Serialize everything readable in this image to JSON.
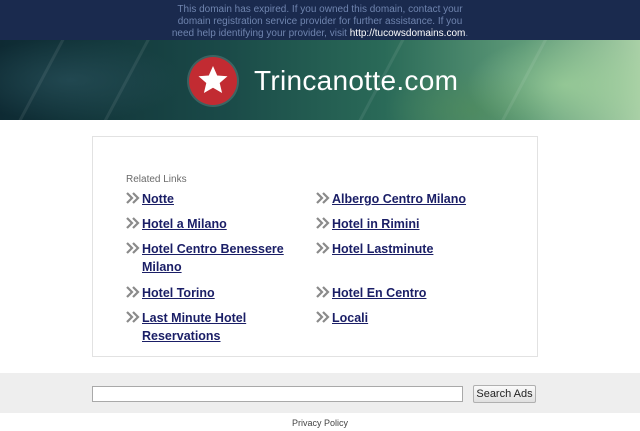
{
  "notice": {
    "line1": "This domain has expired. If you owned this domain, contact your",
    "line2": "domain registration service provider for further assistance. If you",
    "line3_prefix": "need help identifying your provider, visit ",
    "line3_link": "http://tucowsdomains.com",
    "line3_suffix": "."
  },
  "banner": {
    "site_title": "Trincanotte.com",
    "logo_icon": "star-icon",
    "logo_color": "#c22b32"
  },
  "related_links": {
    "label": "Related Links",
    "chevron_icon": "double-chevron-right-icon",
    "link_color": "#1a1e66",
    "left": [
      {
        "line1": "Notte",
        "line2": ""
      },
      {
        "line1": "Hotel a Milano",
        "line2": ""
      },
      {
        "line1": "Hotel Centro Benessere",
        "line2": "Milano"
      },
      {
        "line1": "Hotel Torino",
        "line2": ""
      },
      {
        "line1": "Last Minute Hotel",
        "line2": "Reservations"
      }
    ],
    "right": [
      {
        "line1": "Albergo Centro Milano",
        "line2": ""
      },
      {
        "line1": "Hotel in Rimini",
        "line2": ""
      },
      {
        "line1": "Hotel Lastminute",
        "line2": ""
      },
      {
        "line1": "Hotel En Centro",
        "line2": ""
      },
      {
        "line1": "Locali",
        "line2": ""
      }
    ]
  },
  "search": {
    "value": "",
    "button_label": "Search Ads"
  },
  "footer": {
    "privacy_label": "Privacy Policy"
  }
}
